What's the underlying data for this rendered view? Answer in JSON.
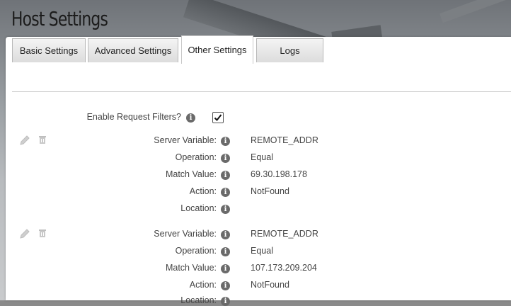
{
  "page": {
    "title": "Host Settings"
  },
  "tabs": [
    {
      "label": "Basic Settings"
    },
    {
      "label": "Advanced Settings"
    },
    {
      "label": "Other Settings",
      "active": true
    },
    {
      "label": "Logs"
    }
  ],
  "request_filters": {
    "enable_label": "Enable Request Filters?",
    "enabled": true
  },
  "field_labels": {
    "server_variable": "Server Variable:",
    "operation": "Operation:",
    "match_value": "Match Value:",
    "action": "Action:",
    "location": "Location:"
  },
  "filters": [
    {
      "server_variable": "REMOTE_ADDR",
      "operation": "Equal",
      "match_value": "69.30.198.178",
      "action": "NotFound",
      "location": ""
    },
    {
      "server_variable": "REMOTE_ADDR",
      "operation": "Equal",
      "match_value": "107.173.209.204",
      "action": "NotFound",
      "location": ""
    }
  ],
  "icons": {
    "info": "info-icon",
    "edit": "pencil-icon",
    "delete": "trash-icon"
  },
  "colors": {
    "accent": "#6a6a6a",
    "panel": "#ffffff"
  }
}
